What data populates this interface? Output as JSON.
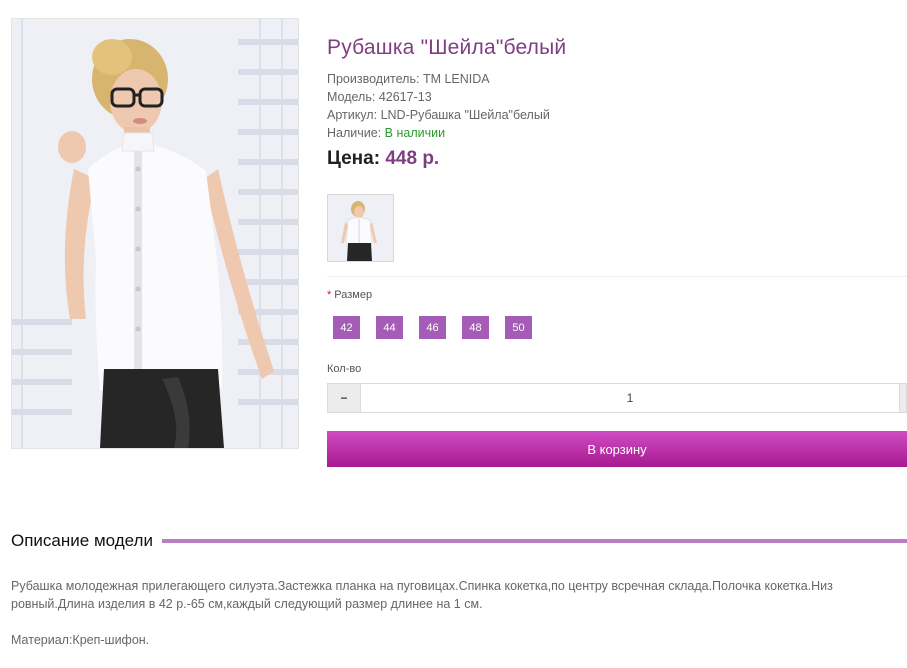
{
  "product": {
    "title": "Рубашка \"Шейла\"белый",
    "manufacturer_label": "Производитель:",
    "manufacturer": "TM LENIDA",
    "model_label": "Модель:",
    "model": "42617-13",
    "article_label": "Артикул:",
    "article": "LND-Рубашка \"Шейла\"белый",
    "availability_label": "Наличие:",
    "availability": "В наличии",
    "price_label": "Цена:",
    "price": "448 р."
  },
  "options": {
    "size_required": "*",
    "size_label": "Размер",
    "sizes": [
      "42",
      "44",
      "46",
      "48",
      "50"
    ],
    "qty_label": "Кол-во",
    "qty_minus": "−",
    "qty_value": "1",
    "cart_button": "В корзину"
  },
  "description": {
    "heading": "Описание модели",
    "text": "Рубашка молодежная прилегающего силуэта.Застежка планка на пуговицах.Спинка кокетка,по центру всречная склада.Полочка кокетка.Низ ровный.Длина изделия в 42 р.-65 см,каждый следующий размер длинее на 1 см.",
    "material": "Материал:Креп-шифон."
  },
  "colors": {
    "accent": "#7d3e82",
    "size_button": "#a45cb7",
    "cart_button": "#c03ab4",
    "in_stock": "#2c9a2c",
    "required": "#d01a1a"
  }
}
